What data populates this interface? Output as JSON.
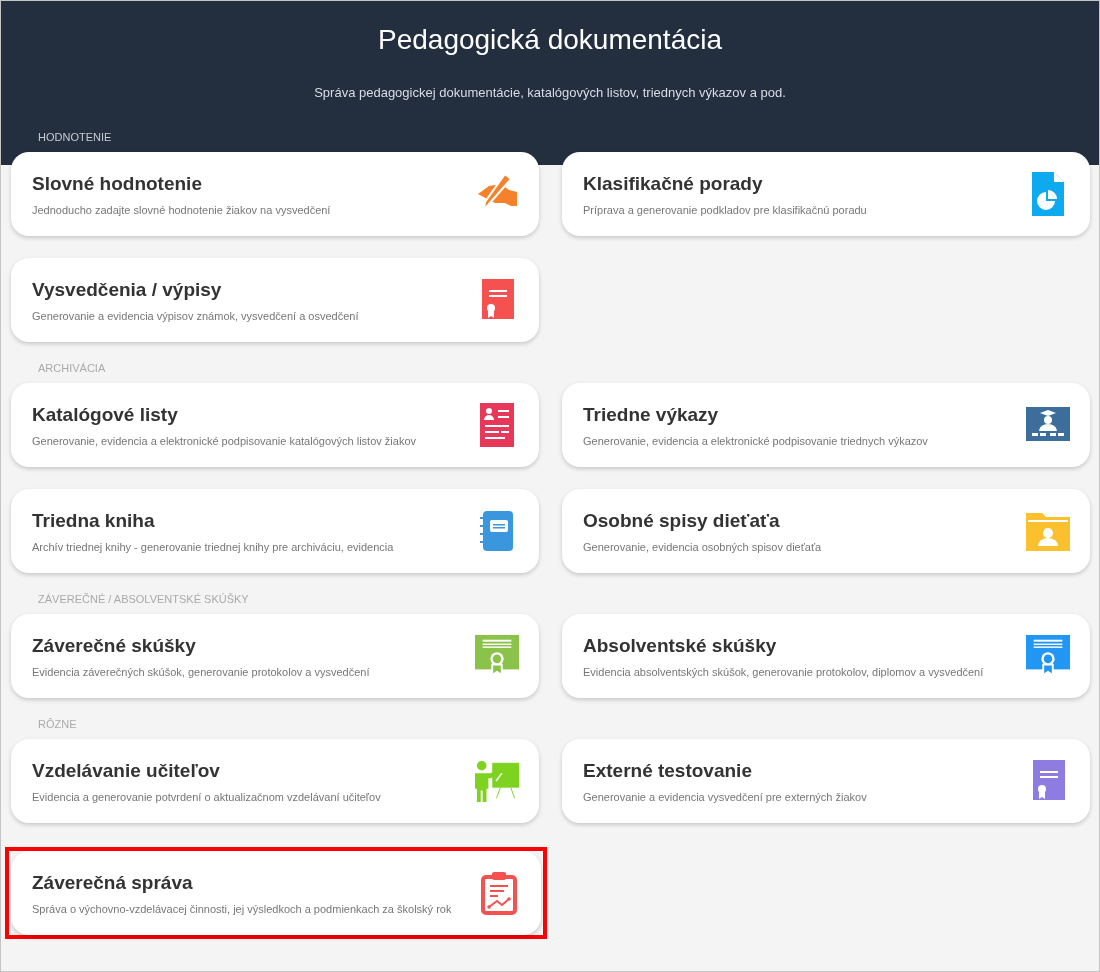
{
  "header": {
    "title": "Pedagogická dokumentácia",
    "subtitle": "Správa pedagogickej dokumentácie, katalógových listov, triednych výkazov a pod."
  },
  "sections": [
    {
      "label": "HODNOTENIE",
      "cards": [
        {
          "title": "Slovné hodnotenie",
          "description": "Jednoducho zadajte slovné hodnotenie žiakov na vysvedčení",
          "highlighted": false
        },
        {
          "title": "Klasifikačné porady",
          "description": "Príprava a generovanie podkladov pre klasifikačnú poradu",
          "highlighted": false
        },
        {
          "title": "Vysvedčenia / výpisy",
          "description": "Generovanie a evidencia výpisov známok, vysvedčení a osvedčení",
          "highlighted": false
        }
      ]
    },
    {
      "label": "ARCHIVÁCIA",
      "cards": [
        {
          "title": "Katalógové listy",
          "description": "Generovanie, evidencia a elektronické podpisovanie katalógových listov žiakov",
          "highlighted": false
        },
        {
          "title": "Triedne výkazy",
          "description": "Generovanie, evidencia a elektronické podpisovanie triednych výkazov",
          "highlighted": false
        },
        {
          "title": "Triedna kniha",
          "description": "Archív triednej knihy - generovanie triednej knihy pre archiváciu, evidencia",
          "highlighted": false
        },
        {
          "title": "Osobné spisy dieťaťa",
          "description": "Generovanie, evidencia osobných spisov dieťaťa",
          "highlighted": false
        }
      ]
    },
    {
      "label": "ZÁVEREČNÉ / ABSOLVENTSKÉ SKÚŠKY",
      "cards": [
        {
          "title": "Záverečné skúšky",
          "description": "Evidencia záverečných skúšok, generovanie protokolov a vysvedčení",
          "highlighted": false
        },
        {
          "title": "Absolventské skúšky",
          "description": "Evidencia absolventských skúšok, generovanie protokolov, diplomov a vysvedčení",
          "highlighted": false
        }
      ]
    },
    {
      "label": "RÔZNE",
      "cards": [
        {
          "title": "Vzdelávanie učiteľov",
          "description": "Evidencia a generovanie potvrdení o aktualizačnom vzdelávaní učiteľov",
          "highlighted": false
        },
        {
          "title": "Externé testovanie",
          "description": "Generovanie a evidencia vysvedčení pre externých žiakov",
          "highlighted": false
        },
        {
          "title": "Záverečná správa",
          "description": "Správa o výchovno-vzdelávacej činnosti, jej výsledkoch a podmienkach za školský rok",
          "highlighted": true
        }
      ]
    }
  ]
}
